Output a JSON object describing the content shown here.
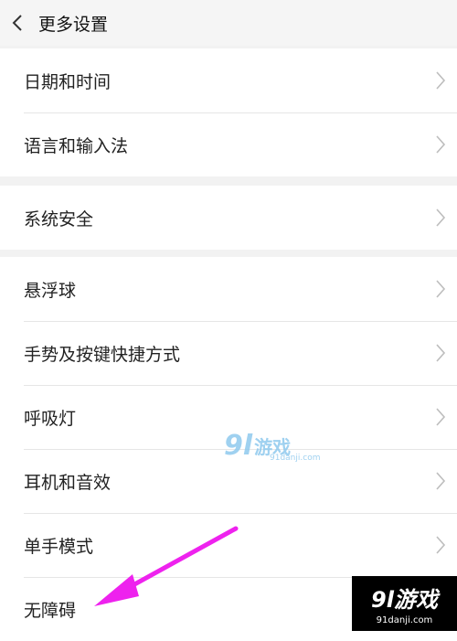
{
  "header": {
    "title": "更多设置",
    "back_icon": "chevron-left-icon"
  },
  "groups": [
    {
      "items": [
        {
          "label": "日期和时间"
        },
        {
          "label": "语言和输入法"
        }
      ]
    },
    {
      "items": [
        {
          "label": "系统安全"
        }
      ]
    },
    {
      "items": [
        {
          "label": "悬浮球"
        },
        {
          "label": "手势及按键快捷方式"
        },
        {
          "label": "呼吸灯"
        },
        {
          "label": "耳机和音效"
        },
        {
          "label": "单手模式"
        },
        {
          "label": "无障碍"
        }
      ]
    }
  ],
  "watermark": {
    "logo": "9l",
    "text": "游戏",
    "url": "91danji.com"
  },
  "corner_logo": {
    "main": "9l游戏",
    "url": "91danji.com"
  },
  "colors": {
    "arrow": "#ee22ee",
    "background": "#f2f2f2",
    "row": "#ffffff",
    "chevron": "#bdbdbd"
  }
}
